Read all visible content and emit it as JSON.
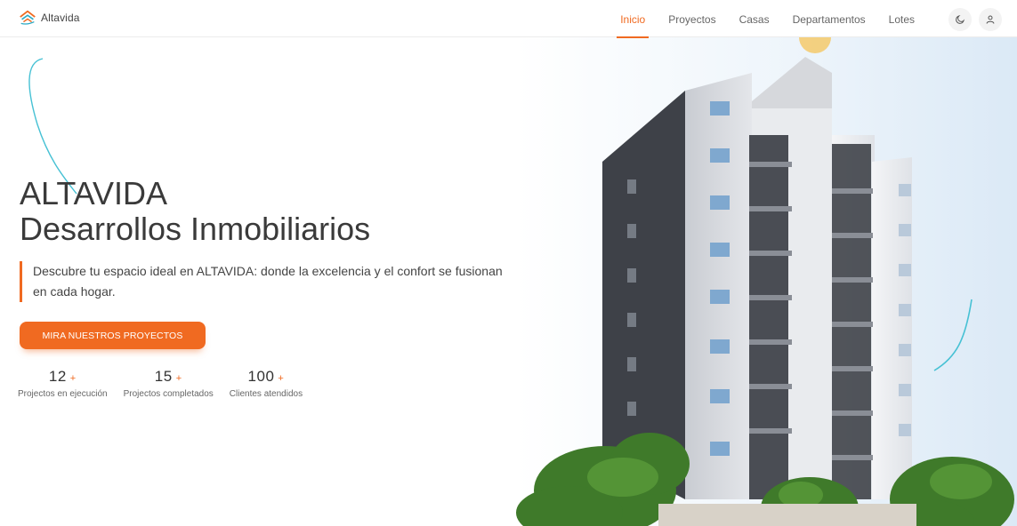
{
  "brand": {
    "name": "Altavida",
    "accent_color": "#f06a21",
    "logo_icon": "house-roof-icon"
  },
  "nav": {
    "items": [
      {
        "label": "Inicio",
        "active": true
      },
      {
        "label": "Proyectos",
        "active": false
      },
      {
        "label": "Casas",
        "active": false
      },
      {
        "label": "Departamentos",
        "active": false
      },
      {
        "label": "Lotes",
        "active": false
      }
    ],
    "theme_toggle_icon": "moon-icon",
    "user_icon": "user-icon"
  },
  "hero": {
    "title_line1": "ALTAVIDA",
    "title_line2": "Desarrollos Inmobiliarios",
    "description": "Descubre tu espacio ideal en ALTAVIDA: donde la excelencia y el confort se fusionan en cada hogar.",
    "cta_label": "MIRA NUESTROS PROYECTOS"
  },
  "stats": [
    {
      "value": "12",
      "plus": "+",
      "label": "Projectos en ejecución"
    },
    {
      "value": "15",
      "plus": "+",
      "label": "Projectos completados"
    },
    {
      "value": "100",
      "plus": "+",
      "label": "Clientes atendidos"
    }
  ]
}
